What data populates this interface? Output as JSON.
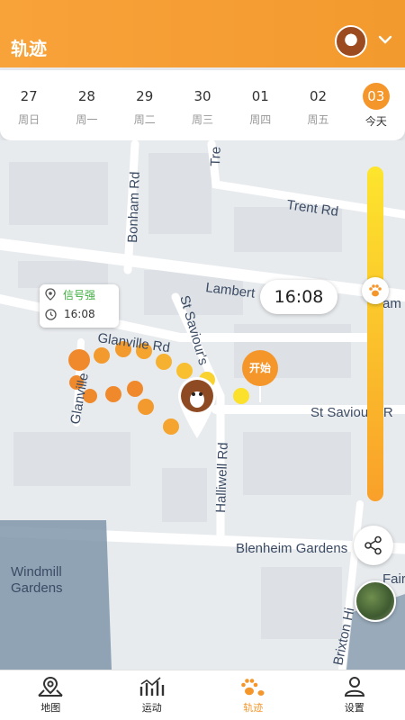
{
  "header": {
    "title": "轨迹"
  },
  "dates": [
    {
      "num": "27",
      "weekday": "周日"
    },
    {
      "num": "28",
      "weekday": "周一"
    },
    {
      "num": "29",
      "weekday": "周二"
    },
    {
      "num": "30",
      "weekday": "周三"
    },
    {
      "num": "01",
      "weekday": "周四"
    },
    {
      "num": "02",
      "weekday": "周五"
    },
    {
      "num": "03",
      "weekday": "今天",
      "active": true
    }
  ],
  "map": {
    "streets": {
      "trent": "Trent Rd",
      "bonham": "Bonham Rd",
      "lambert": "Lambert",
      "lambert_end": "am",
      "glanville": "Glanville Rd",
      "glanville2": "Glanville",
      "st_saviours": "St Saviour's",
      "st_saviours_rd": "St Saviours R",
      "halliwell": "Halliwell Rd",
      "blenheim": "Blenheim Gardens",
      "windmill": "Windmill",
      "gardens": "Gardens",
      "brixton": "Brixton Hi",
      "tre": "Tre",
      "fair": "Fair"
    },
    "signal": {
      "strength": "信号强",
      "time": "16:08"
    },
    "time_bubble": "16:08",
    "start_label": "开始",
    "slider_position": 0.36
  },
  "tabs": [
    {
      "label": "地图",
      "icon": "map-pin-icon"
    },
    {
      "label": "运动",
      "icon": "chart-icon"
    },
    {
      "label": "轨迹",
      "icon": "paw-icon",
      "active": true
    },
    {
      "label": "设置",
      "icon": "person-icon"
    }
  ],
  "colors": {
    "accent": "#f5962b",
    "header": "#f8a23a",
    "signal_good": "#3fae3f"
  }
}
